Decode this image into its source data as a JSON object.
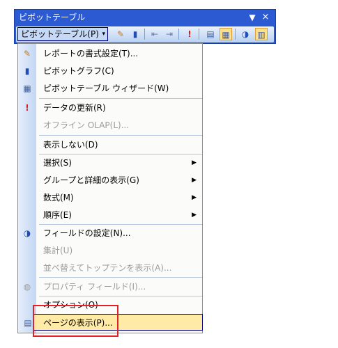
{
  "window": {
    "title": "ピボットテーブル",
    "dropdown_glyph": "▼",
    "close_glyph": "×"
  },
  "toolbar": {
    "menu_button_label": "ピボットテーブル(P)",
    "menu_button_arrow": "▾",
    "buttons": [
      {
        "name": "format-report-icon",
        "glyph": "✎"
      },
      {
        "name": "chart-icon",
        "glyph": "▮"
      },
      {
        "name": "hide-detail-icon",
        "glyph": "⇤"
      },
      {
        "name": "show-detail-icon",
        "glyph": "⇥"
      },
      {
        "name": "refresh-icon",
        "glyph": "!"
      },
      {
        "name": "field-list-icon",
        "glyph": "▤"
      },
      {
        "name": "always-display-items-icon",
        "glyph": "▦"
      },
      {
        "name": "field-settings-icon",
        "glyph": "◑"
      },
      {
        "name": "show-field-list-icon",
        "glyph": "▥"
      }
    ]
  },
  "menu": {
    "items": [
      {
        "label": "レポートの書式設定(T)...",
        "icon": "✎",
        "enabled": true
      },
      {
        "label": "ピボットグラフ(C)",
        "icon": "▮",
        "enabled": true
      },
      {
        "label": "ピボットテーブル ウィザード(W)",
        "icon": "▦",
        "enabled": true
      },
      {
        "label": "データの更新(R)",
        "icon": "!",
        "enabled": true
      },
      {
        "label": "オフライン OLAP(L)...",
        "icon": "",
        "enabled": false
      },
      {
        "label": "表示しない(D)",
        "icon": "",
        "enabled": true
      },
      {
        "label": "選択(S)",
        "icon": "",
        "enabled": true,
        "submenu": true
      },
      {
        "label": "グループと詳細の表示(G)",
        "icon": "",
        "enabled": true,
        "submenu": true
      },
      {
        "label": "数式(M)",
        "icon": "",
        "enabled": true,
        "submenu": true
      },
      {
        "label": "順序(E)",
        "icon": "",
        "enabled": true,
        "submenu": true
      },
      {
        "label": "フィールドの設定(N)...",
        "icon": "◑",
        "enabled": true
      },
      {
        "label": "集計(U)",
        "icon": "",
        "enabled": false
      },
      {
        "label": "並べ替えてトップテンを表示(A)...",
        "icon": "",
        "enabled": false
      },
      {
        "label": "プロパティ フィールド(I)...",
        "icon": "◍",
        "enabled": false
      },
      {
        "label": "オプション(O)",
        "icon": "",
        "enabled": true
      },
      {
        "label": "ページの表示(P)...",
        "icon": "▤",
        "enabled": true,
        "highlighted": true
      }
    ],
    "submenu_glyph": "▶"
  },
  "colors": {
    "title_bar": "#2c5ad2",
    "highlight": "#ffeaa6",
    "annotation": "#e42027"
  }
}
